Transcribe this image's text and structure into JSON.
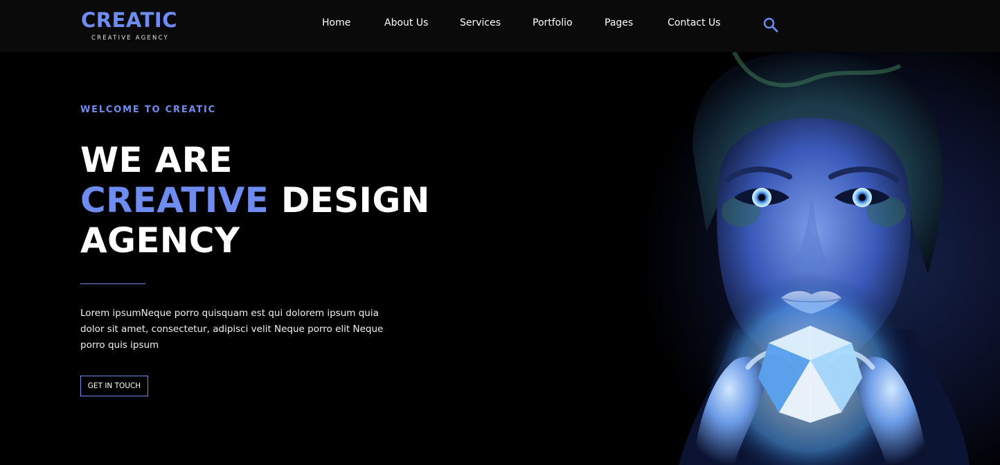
{
  "brand": {
    "name": "CREATIC",
    "tagline": "CREATIVE AGENCY",
    "accent_color": "#6f8cf0"
  },
  "nav": {
    "items": [
      {
        "label": "Home"
      },
      {
        "label": "About Us"
      },
      {
        "label": "Services"
      },
      {
        "label": "Portfolio"
      },
      {
        "label": "Pages"
      },
      {
        "label": "Contact Us"
      }
    ],
    "search_icon": "search-icon"
  },
  "hero": {
    "eyebrow": "WELCOME TO CREATIC",
    "headline_line1": "WE ARE",
    "headline_accent": "CREATIVE",
    "headline_line2_rest": " DESIGN",
    "headline_line3": "AGENCY",
    "body": "Lorem ipsumNeque porro quisquam est qui dolorem ipsum quia dolor sit amet, consectetur, adipisci velit Neque porro elit Neque porro quis ipsum",
    "cta_label": "GET IN TOUCH",
    "image_subject": "woman with glowing blue crystal"
  }
}
